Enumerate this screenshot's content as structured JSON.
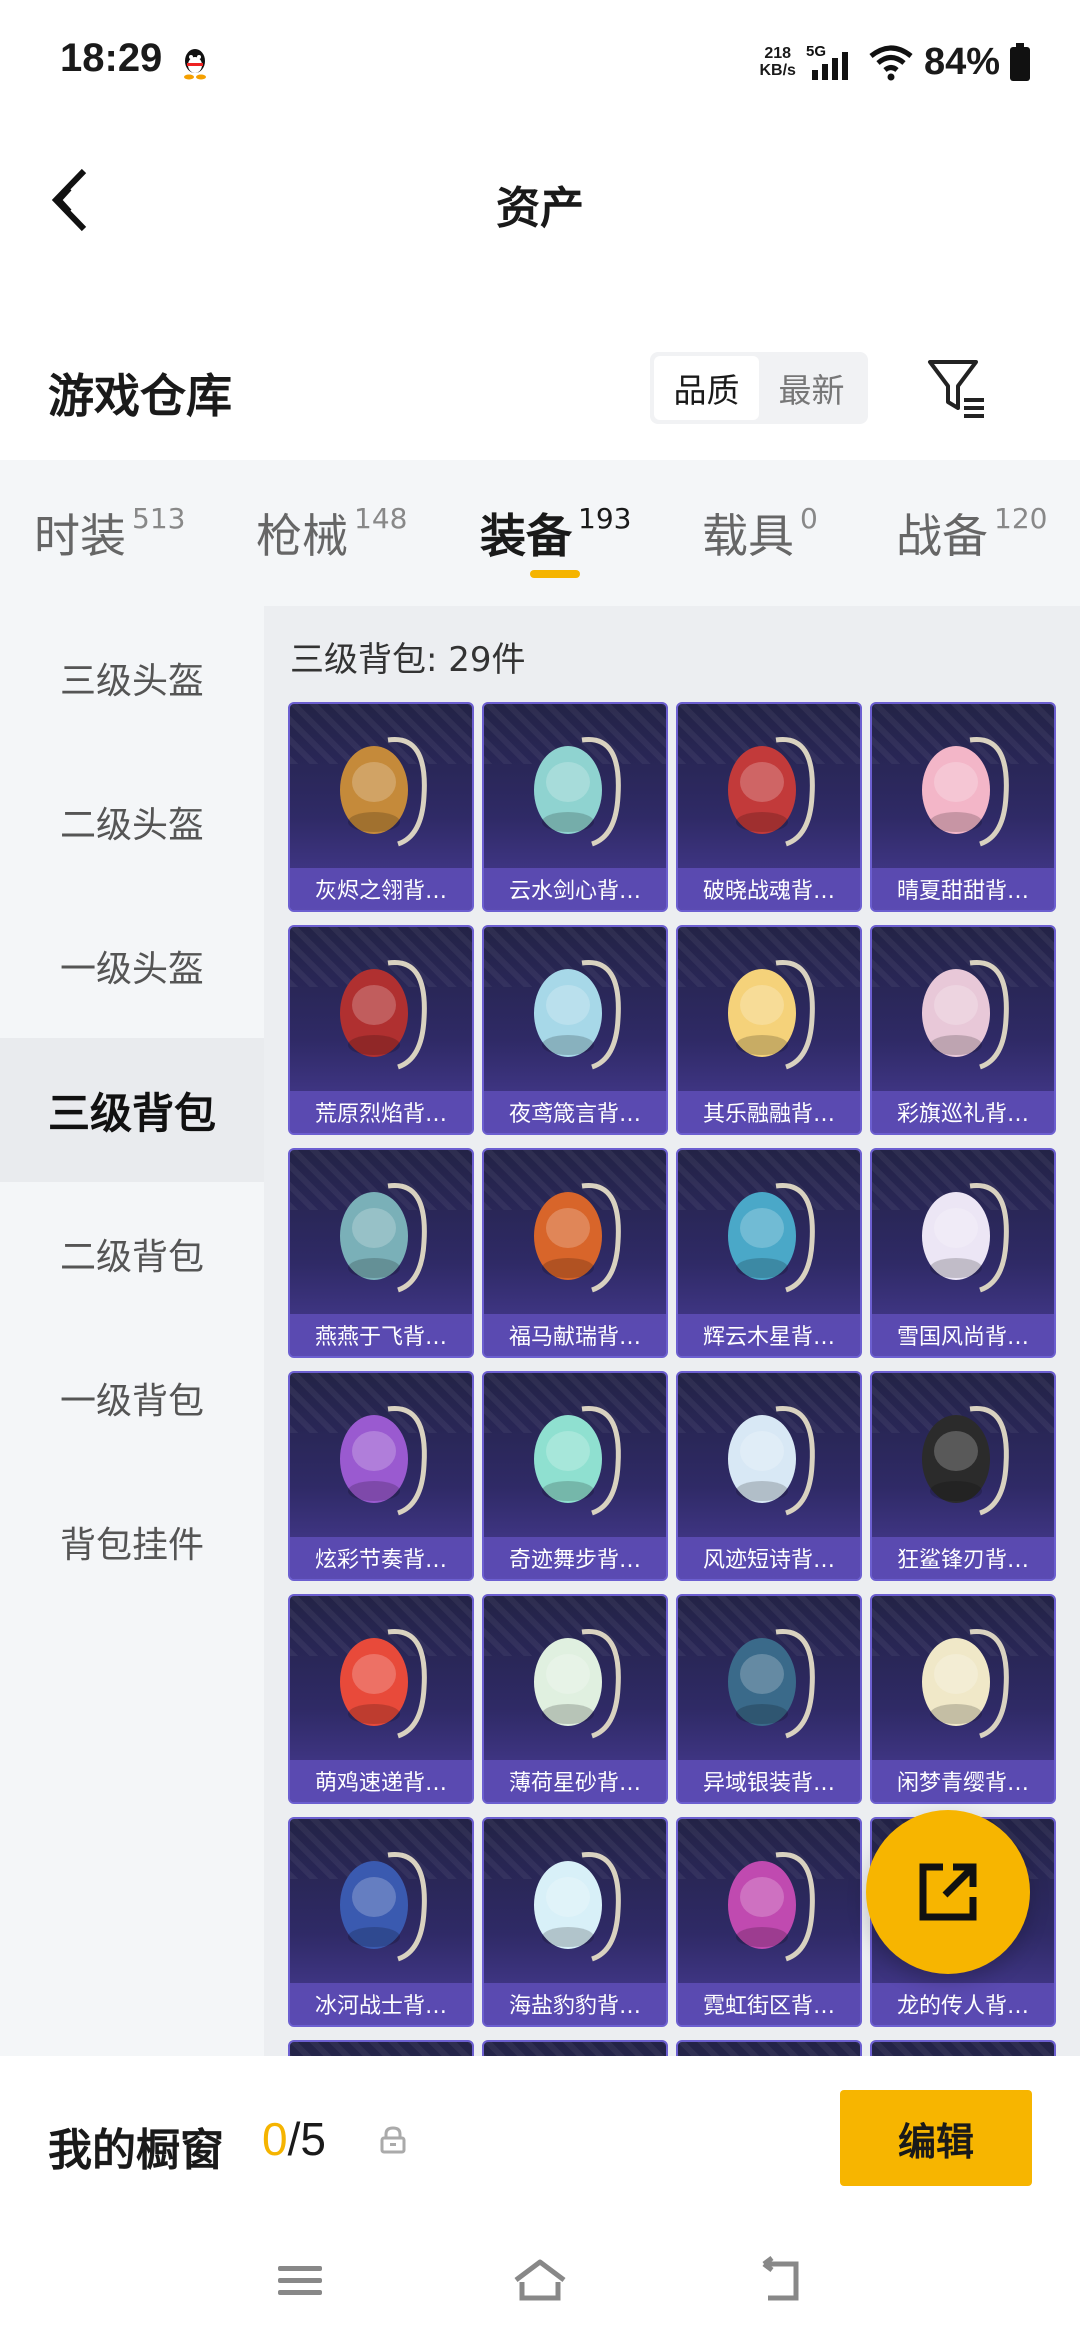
{
  "status_bar": {
    "time": "18:29",
    "net_speed_value": "218",
    "net_speed_unit": "KB/s",
    "network": "5G",
    "battery": "84%"
  },
  "header": {
    "title": "资产"
  },
  "section": {
    "title": "游戏仓库",
    "sort_options": [
      "品质",
      "最新"
    ],
    "active_sort": "品质"
  },
  "tabs": [
    {
      "label": "时装",
      "count": "513"
    },
    {
      "label": "枪械",
      "count": "148"
    },
    {
      "label": "装备",
      "count": "193"
    },
    {
      "label": "载具",
      "count": "0"
    },
    {
      "label": "战备",
      "count": "120"
    }
  ],
  "active_tab": "装备",
  "sidebar": {
    "items": [
      "三级头盔",
      "二级头盔",
      "一级头盔",
      "三级背包",
      "二级背包",
      "一级背包",
      "背包挂件"
    ],
    "active": "三级背包"
  },
  "grid": {
    "heading": "三级背包: 29件",
    "items": [
      "灰烬之翎背…",
      "云水剑心背…",
      "破晓战魂背…",
      "晴夏甜甜背…",
      "荒原烈焰背…",
      "夜鸢箴言背…",
      "其乐融融背…",
      "彩旗巡礼背…",
      "燕燕于飞背…",
      "福马献瑞背…",
      "辉云木星背…",
      "雪国风尚背…",
      "炫彩节奏背…",
      "奇迹舞步背…",
      "风迹短诗背…",
      "狂鲨锋刃背…",
      "萌鸡速递背…",
      "薄荷星砂背…",
      "异域银装背…",
      "闲梦青缨背…",
      "冰河战士背…",
      "海盐豹豹背…",
      "霓虹街区背…",
      "龙的传人背…"
    ],
    "item_colors": [
      "#c58a3a",
      "#8fd3d0",
      "#c23a3a",
      "#f3b6c8",
      "#b03030",
      "#a7d8e8",
      "#f5d27a",
      "#e8c8d8",
      "#7ab0b8",
      "#d8652a",
      "#4aa8c8",
      "#ece6f5",
      "#9a5ad0",
      "#8fe0d0",
      "#d8e8f5",
      "#2b2b2b",
      "#e84a3a",
      "#e0f0e0",
      "#3a6a8a",
      "#f0e8c8",
      "#3a5ab0",
      "#d8f0f8",
      "#c04ab0",
      "#cccccc"
    ]
  },
  "showcase": {
    "label": "我的橱窗",
    "current": "0",
    "separator": "/",
    "max": "5",
    "edit_label": "编辑"
  }
}
